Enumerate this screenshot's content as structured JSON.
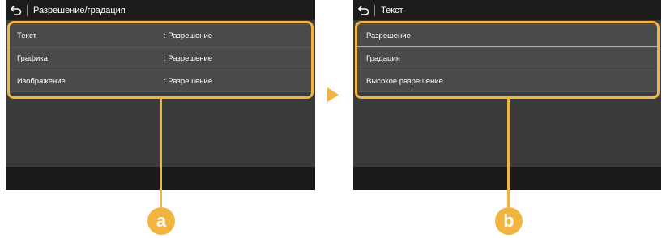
{
  "left_screen": {
    "title": "Разрешение/градация",
    "rows": [
      {
        "label": "Текст",
        "value": ": Разрешение"
      },
      {
        "label": "Графика",
        "value": ": Разрешение"
      },
      {
        "label": "Изображение",
        "value": ": Разрешение"
      }
    ]
  },
  "right_screen": {
    "title": "Текст",
    "options": [
      {
        "label": "Разрешение",
        "selected": true
      },
      {
        "label": "Градация",
        "selected": false
      },
      {
        "label": "Высокое разрешение",
        "selected": false
      }
    ]
  },
  "callouts": {
    "a": "a",
    "b": "b"
  },
  "colors": {
    "accent": "#f2b441",
    "screen_bg": "#3b3b3b",
    "titlebar_bg": "#1c1c1c"
  },
  "icons": {
    "back": "back-arrow-icon",
    "next": "triangle-right-icon"
  }
}
